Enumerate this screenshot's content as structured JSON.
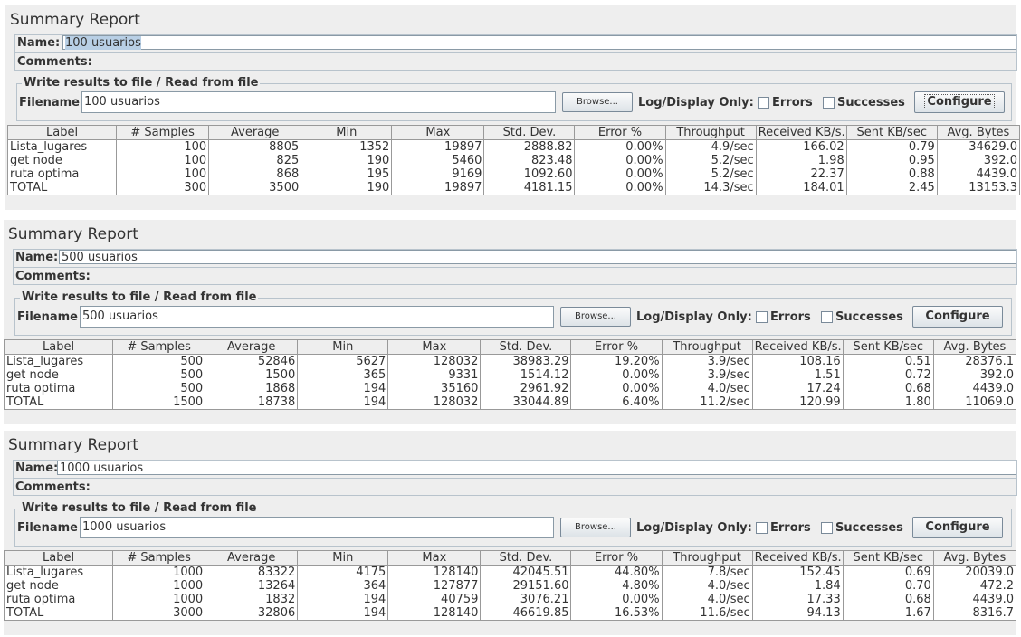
{
  "reports": [
    {
      "title": "Summary Report",
      "name_label": "Name:",
      "name_value": "100 usuarios",
      "comments_label": "Comments:",
      "file_section": "Write results to file / Read from file",
      "filename_label": "Filename",
      "filename_value": "100 usuarios",
      "browse_label": "Browse...",
      "log_display_label": "Log/Display Only:",
      "errors_label": "Errors",
      "successes_label": "Successes",
      "configure_label": "Configure",
      "columns": [
        "Label",
        "# Samples",
        "Average",
        "Min",
        "Max",
        "Std. Dev.",
        "Error %",
        "Throughput",
        "Received KB/s...",
        "Sent KB/sec",
        "Avg. Bytes"
      ],
      "rows": [
        [
          "Lista_lugares",
          "100",
          "8805",
          "1352",
          "19897",
          "2888.82",
          "0.00%",
          "4.9/sec",
          "166.02",
          "0.79",
          "34629.0"
        ],
        [
          "get node",
          "100",
          "825",
          "190",
          "5460",
          "823.48",
          "0.00%",
          "5.2/sec",
          "1.98",
          "0.95",
          "392.0"
        ],
        [
          "ruta optima",
          "100",
          "868",
          "195",
          "9169",
          "1092.60",
          "0.00%",
          "5.2/sec",
          "22.37",
          "0.88",
          "4439.0"
        ],
        [
          "TOTAL",
          "300",
          "3500",
          "190",
          "19897",
          "4181.15",
          "0.00%",
          "14.3/sec",
          "184.01",
          "2.45",
          "13153.3"
        ]
      ]
    },
    {
      "title": "Summary Report",
      "name_label": "Name:",
      "name_value": "500 usuarios",
      "comments_label": "Comments:",
      "file_section": "Write results to file / Read from file",
      "filename_label": "Filename",
      "filename_value": "500 usuarios",
      "browse_label": "Browse...",
      "log_display_label": "Log/Display Only:",
      "errors_label": "Errors",
      "successes_label": "Successes",
      "configure_label": "Configure",
      "columns": [
        "Label",
        "# Samples",
        "Average",
        "Min",
        "Max",
        "Std. Dev.",
        "Error %",
        "Throughput",
        "Received KB/s...",
        "Sent KB/sec",
        "Avg. Bytes"
      ],
      "rows": [
        [
          "Lista_lugares",
          "500",
          "52846",
          "5627",
          "128032",
          "38983.29",
          "19.20%",
          "3.9/sec",
          "108.16",
          "0.51",
          "28376.1"
        ],
        [
          "get node",
          "500",
          "1500",
          "365",
          "9331",
          "1514.12",
          "0.00%",
          "3.9/sec",
          "1.51",
          "0.72",
          "392.0"
        ],
        [
          "ruta optima",
          "500",
          "1868",
          "194",
          "35160",
          "2961.92",
          "0.00%",
          "4.0/sec",
          "17.24",
          "0.68",
          "4439.0"
        ],
        [
          "TOTAL",
          "1500",
          "18738",
          "194",
          "128032",
          "33044.89",
          "6.40%",
          "11.2/sec",
          "120.99",
          "1.80",
          "11069.0"
        ]
      ]
    },
    {
      "title": "Summary Report",
      "name_label": "Name:",
      "name_value": "1000 usuarios",
      "comments_label": "Comments:",
      "file_section": "Write results to file / Read from file",
      "filename_label": "Filename",
      "filename_value": "1000 usuarios",
      "browse_label": "Browse...",
      "log_display_label": "Log/Display Only:",
      "errors_label": "Errors",
      "successes_label": "Successes",
      "configure_label": "Configure",
      "columns": [
        "Label",
        "# Samples",
        "Average",
        "Min",
        "Max",
        "Std. Dev.",
        "Error %",
        "Throughput",
        "Received KB/s...",
        "Sent KB/sec",
        "Avg. Bytes"
      ],
      "rows": [
        [
          "Lista_lugares",
          "1000",
          "83322",
          "4175",
          "128140",
          "42045.51",
          "44.80%",
          "7.8/sec",
          "152.45",
          "0.69",
          "20039.0"
        ],
        [
          "get node",
          "1000",
          "13264",
          "364",
          "127877",
          "29151.60",
          "4.80%",
          "4.0/sec",
          "1.84",
          "0.70",
          "472.2"
        ],
        [
          "ruta optima",
          "1000",
          "1832",
          "194",
          "40759",
          "3076.21",
          "0.00%",
          "4.0/sec",
          "17.33",
          "0.68",
          "4439.0"
        ],
        [
          "TOTAL",
          "3000",
          "32806",
          "194",
          "128140",
          "46619.85",
          "16.53%",
          "11.6/sec",
          "94.13",
          "1.67",
          "8316.7"
        ]
      ]
    }
  ]
}
